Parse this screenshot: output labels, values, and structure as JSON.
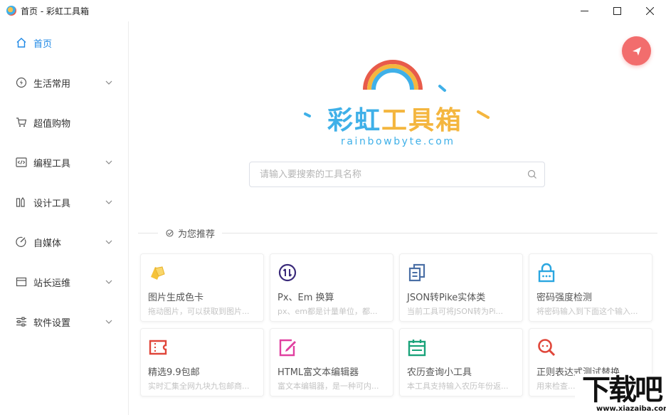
{
  "window": {
    "title": "首页 - 彩虹工具箱",
    "minimize": "—",
    "maximize": "☐",
    "close": "✕"
  },
  "sidebar": {
    "items": [
      {
        "label": "首页",
        "icon": "home-icon",
        "active": true,
        "expandable": false
      },
      {
        "label": "生活常用",
        "icon": "lightning-icon",
        "expandable": true
      },
      {
        "label": "超值购物",
        "icon": "cart-icon",
        "expandable": false
      },
      {
        "label": "编程工具",
        "icon": "code-icon",
        "expandable": true
      },
      {
        "label": "设计工具",
        "icon": "design-icon",
        "expandable": true
      },
      {
        "label": "自媒体",
        "icon": "media-icon",
        "expandable": true
      },
      {
        "label": "站长运维",
        "icon": "server-icon",
        "expandable": true
      },
      {
        "label": "软件设置",
        "icon": "sliders-icon",
        "expandable": true
      }
    ]
  },
  "logo": {
    "title_part1": "彩虹",
    "title_part2": "工具箱",
    "domain": "rainbowbyte.com"
  },
  "search": {
    "placeholder": "请输入要搜索的工具名称"
  },
  "recommend": {
    "title": "为您推荐"
  },
  "cards": [
    {
      "title": "图片生成色卡",
      "desc": "拖动图片，可以获取到图片...",
      "icon": "palette-cards-icon",
      "color": "#f5c33b"
    },
    {
      "title": "Px、Em 换算",
      "desc": "px、em都是计量单位，都...",
      "icon": "convert-icon",
      "color": "#3a2a7a"
    },
    {
      "title": "JSON转Pike实体类",
      "desc": "当前工具可将JSON转为Pi...",
      "icon": "json-copy-icon",
      "color": "#4a6fa5"
    },
    {
      "title": "密码强度检测",
      "desc": "将密码输入到下面这个输入...",
      "icon": "lock-icon",
      "color": "#2aa6e0"
    },
    {
      "title": "精选9.9包邮",
      "desc": "实时汇集全网九块九包邮商...",
      "icon": "ticket-icon",
      "color": "#e0463a"
    },
    {
      "title": "HTML富文本编辑器",
      "desc": "富文本编辑器，是一种可内...",
      "icon": "edit-icon",
      "color": "#e040a0"
    },
    {
      "title": "农历查询小工具",
      "desc": "本工具支持输入农历年份返...",
      "icon": "calendar-icon",
      "color": "#1aa37a"
    },
    {
      "title": "正则表达式测试替换",
      "desc": "用来检查...",
      "icon": "regex-search-icon",
      "color": "#e0463a"
    }
  ],
  "watermark": {
    "main": "下载吧",
    "sub": "www.xiazaiba.com"
  },
  "colors": {
    "accent": "#1e88e5",
    "fab": "#f26d6d",
    "rainbow_blue": "#3fb0e8",
    "rainbow_yellow": "#f4b63f"
  }
}
